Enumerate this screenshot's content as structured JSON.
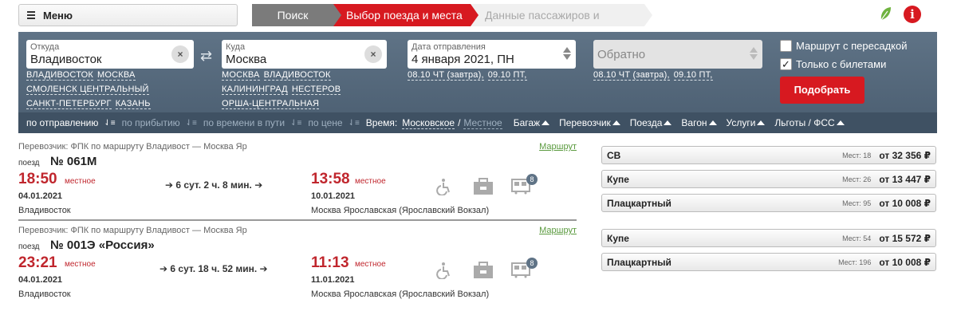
{
  "menu": {
    "label": "Меню"
  },
  "steps": [
    "Поиск билета",
    "Выбор поезда и места",
    "Данные пассажиров и оплата"
  ],
  "colors": {
    "accent_red": "#d71920",
    "panel": "#4e6275",
    "time_red": "#c0262d",
    "link_green": "#5a9a3e"
  },
  "icons": {
    "leaf": "leaf-icon",
    "info": "info-icon",
    "menu": "menu-icon"
  },
  "search": {
    "from": {
      "label": "Откуда",
      "value": "Владивосток"
    },
    "to": {
      "label": "Куда",
      "value": "Москва"
    },
    "date": {
      "label": "Дата отправления",
      "value": "4 января 2021, ПН"
    },
    "return": {
      "value": "Обратно"
    },
    "from_quick": [
      "ВЛАДИВОСТОК",
      "МОСКВА",
      "СМОЛЕНСК ЦЕНТРАЛЬНЫЙ",
      "САНКТ-ПЕТЕРБУРГ",
      "КАЗАНЬ"
    ],
    "to_quick": [
      "МОСКВА",
      "ВЛАДИВОСТОК",
      "КАЛИНИНГРАД",
      "НЕСТЕРОВ",
      "ОРША-ЦЕНТРАЛЬНАЯ"
    ],
    "date_quick": [
      "08.10 ЧТ (завтра),",
      "09.10 ПТ,"
    ],
    "return_quick": [
      "08.10 ЧТ (завтра),",
      "09.10 ПТ,"
    ],
    "transfer_label": "Маршрут с пересадкой",
    "tickets_label": "Только с билетами",
    "submit_label": "Подобрать"
  },
  "filters": {
    "sort_departure": "по отправлению",
    "sort_arrival": "по прибытию",
    "sort_travel": "по времени в пути",
    "sort_price": "по цене",
    "time_label": "Время:",
    "time_moscow": "Московское",
    "time_slash": "/",
    "time_local": "Местное",
    "dropdowns": [
      "Багаж",
      "Перевозчик",
      "Поезда",
      "Вагон",
      "Услуги",
      "Льготы / ФСС"
    ]
  },
  "trains": [
    {
      "carrier": "Перевозчик: ФПК   по маршруту Владивост — Москва Яр",
      "route_link": "Маршрут",
      "number_label": "поезд",
      "number": "№ 061М",
      "dep_time": "18:50",
      "dep_local": "местное",
      "dep_date": "04.01.2021",
      "dep_station": "Владивосток",
      "duration": "6 сут. 2 ч. 8 мин.",
      "arr_time": "13:58",
      "arr_local": "местное",
      "arr_date": "10.01.2021",
      "arr_station": "Москва Ярославская (Ярославский Вокзал)",
      "cars_badge": "8",
      "fares": [
        {
          "class": "СВ",
          "seats": "Мест: 18",
          "from": "от",
          "price": "32 356",
          "currency": "₽"
        },
        {
          "class": "Купе",
          "seats": "Мест: 26",
          "from": "от",
          "price": "13 447",
          "currency": "₽"
        },
        {
          "class": "Плацкартный",
          "seats": "Мест: 95",
          "from": "от",
          "price": "10 008",
          "currency": "₽"
        }
      ]
    },
    {
      "carrier": "Перевозчик: ФПК   по маршруту Владивост — Москва Яр",
      "route_link": "Маршрут",
      "number_label": "поезд",
      "number": "№ 001Э «Россия»",
      "dep_time": "23:21",
      "dep_local": "местное",
      "dep_date": "04.01.2021",
      "dep_station": "Владивосток",
      "duration": "6 сут. 18 ч. 52 мин.",
      "arr_time": "11:13",
      "arr_local": "местное",
      "arr_date": "11.01.2021",
      "arr_station": "Москва Ярославская (Ярославский Вокзал)",
      "cars_badge": "8",
      "fares": [
        {
          "class": "Купе",
          "seats": "Мест: 54",
          "from": "от",
          "price": "15 572",
          "currency": "₽"
        },
        {
          "class": "Плацкартный",
          "seats": "Мест: 196",
          "from": "от",
          "price": "10 008",
          "currency": "₽"
        }
      ]
    }
  ]
}
